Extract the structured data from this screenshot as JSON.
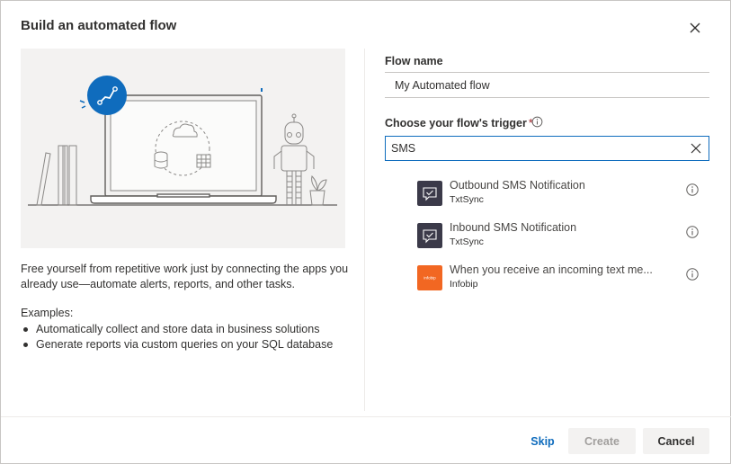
{
  "dialog": {
    "title": "Build an automated flow",
    "description": "Free yourself from repetitive work just by connecting the apps you already use—automate alerts, reports, and other tasks.",
    "examples_heading": "Examples:",
    "examples": [
      "Automatically collect and store data in business solutions",
      "Generate reports via custom queries on your SQL database"
    ]
  },
  "form": {
    "flow_name_label": "Flow name",
    "flow_name_value": "My Automated flow",
    "trigger_label": "Choose your flow's trigger",
    "required_marker": "*",
    "search_value": "SMS"
  },
  "results": [
    {
      "title": "Outbound SMS Notification",
      "connector": "TxtSync",
      "icon": "chat-check-icon",
      "icon_color": "#3b3a49"
    },
    {
      "title": "Inbound SMS Notification",
      "connector": "TxtSync",
      "icon": "chat-check-icon",
      "icon_color": "#3b3a49"
    },
    {
      "title": "When you receive an incoming text me...",
      "connector": "Infobip",
      "icon": "infobip-logo",
      "icon_color": "#f26722",
      "logo_text": "infobip"
    }
  ],
  "footer": {
    "skip_label": "Skip",
    "create_label": "Create",
    "cancel_label": "Cancel"
  },
  "colors": {
    "accent": "#0f6cbd",
    "illustration_bg": "#f3f2f1",
    "required": "#a4262c"
  }
}
